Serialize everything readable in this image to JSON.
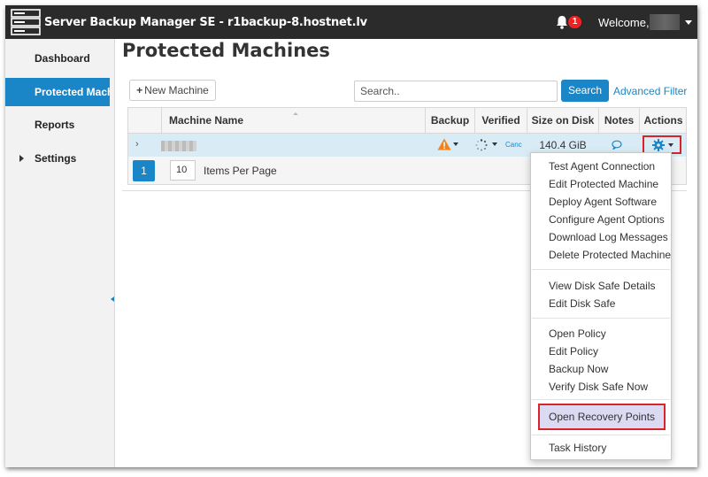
{
  "app": {
    "title": "Server Backup Manager SE - r1backup-8.hostnet.lv",
    "notification_count": "1",
    "welcome": "Welcome,"
  },
  "sidebar": {
    "items": [
      {
        "label": "Dashboard"
      },
      {
        "label": "Protected Mach"
      },
      {
        "label": "Reports"
      },
      {
        "label": "Settings"
      }
    ]
  },
  "main": {
    "title": "Protected Machines",
    "new_machine_label": "New Machine",
    "search_placeholder": "Search..",
    "search_button": "Search",
    "advanced_filter": "Advanced Filter"
  },
  "table": {
    "columns": [
      "Machine Name",
      "Backup",
      "Verified",
      "Size on Disk",
      "Notes",
      "Actions"
    ],
    "rows": [
      {
        "verified_text": "Canc",
        "size": "140.4 GiB"
      }
    ]
  },
  "pagination": {
    "current_page": "1",
    "per_page": "10",
    "per_page_label": "Items Per Page"
  },
  "actions_menu": {
    "groups": [
      [
        "Test Agent Connection",
        "Edit Protected Machine",
        "Deploy Agent Software",
        "Configure Agent Options",
        "Download Log Messages",
        "Delete Protected Machine"
      ],
      [
        "View Disk Safe Details",
        "Edit Disk Safe"
      ],
      [
        "Open Policy",
        "Edit Policy",
        "Backup Now",
        "Verify Disk Safe Now"
      ],
      [
        "Open Recovery Points"
      ],
      [
        "Task History"
      ]
    ],
    "highlighted": "Open Recovery Points"
  },
  "colors": {
    "topbar": "#2b2b2b",
    "accent": "#1a86c8",
    "highlight_border": "#d8232a",
    "warning": "#f0841e",
    "row_selected": "#d9ecf5"
  },
  "icons": [
    "server-logo-icon",
    "bell-icon",
    "caret-down-icon",
    "plus-icon",
    "chevron-right-icon",
    "warning-icon",
    "spinner-icon",
    "speech-bubble-icon",
    "gear-icon",
    "collapse-arrow-icon"
  ]
}
